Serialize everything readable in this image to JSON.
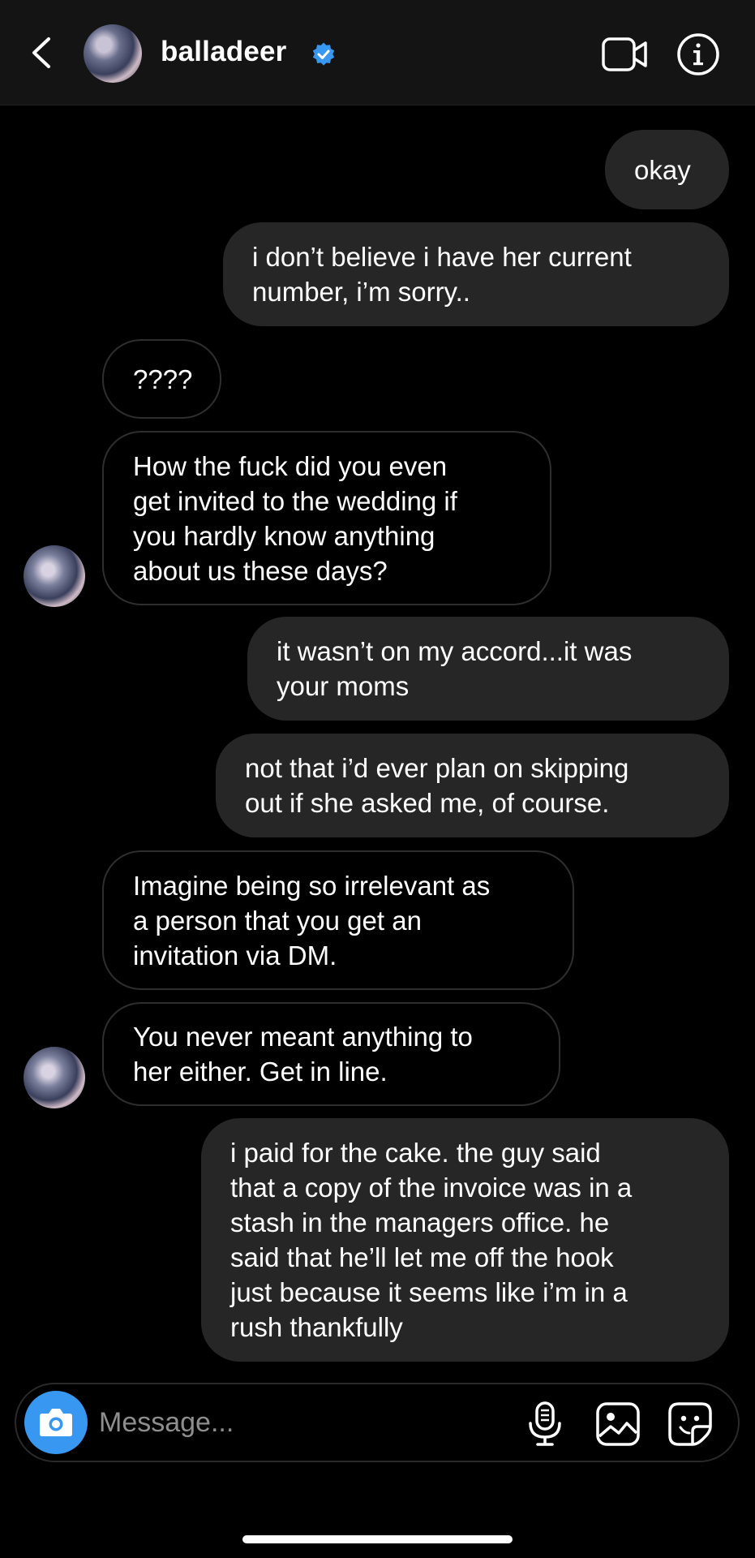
{
  "header": {
    "username": "balladeer",
    "verified": true,
    "accent_color": "#3897f0"
  },
  "messages": [
    {
      "direction": "outgoing",
      "text": "okay"
    },
    {
      "direction": "outgoing",
      "text": "i don’t believe i have her current\nnumber, i’m sorry.."
    },
    {
      "direction": "incoming",
      "text": "????"
    },
    {
      "direction": "incoming",
      "text": "How the fuck did you even\nget invited to the wedding if\nyou hardly know anything\nabout us these days?"
    },
    {
      "direction": "outgoing",
      "text": "it wasn’t on my accord...it was\nyour moms"
    },
    {
      "direction": "outgoing",
      "text": "not that i’d ever plan on skipping\nout if she asked me, of course."
    },
    {
      "direction": "incoming",
      "text": "Imagine being so irrelevant as\na person that you get an\ninvitation via DM."
    },
    {
      "direction": "incoming",
      "text": "You never meant anything to\nher either. Get in line."
    },
    {
      "direction": "outgoing",
      "text": "i paid for the cake. the guy said\nthat a copy of the invoice was in a\nstash in the managers office. he\nsaid that he’ll let me off the hook\njust because it seems like i’m in a\nrush thankfully"
    }
  ],
  "composer": {
    "placeholder": "Message..."
  },
  "icons": [
    "back-arrow-icon",
    "verified-badge-icon",
    "video-call-icon",
    "info-icon",
    "camera-icon",
    "microphone-icon",
    "gallery-icon",
    "sticker-icon"
  ]
}
